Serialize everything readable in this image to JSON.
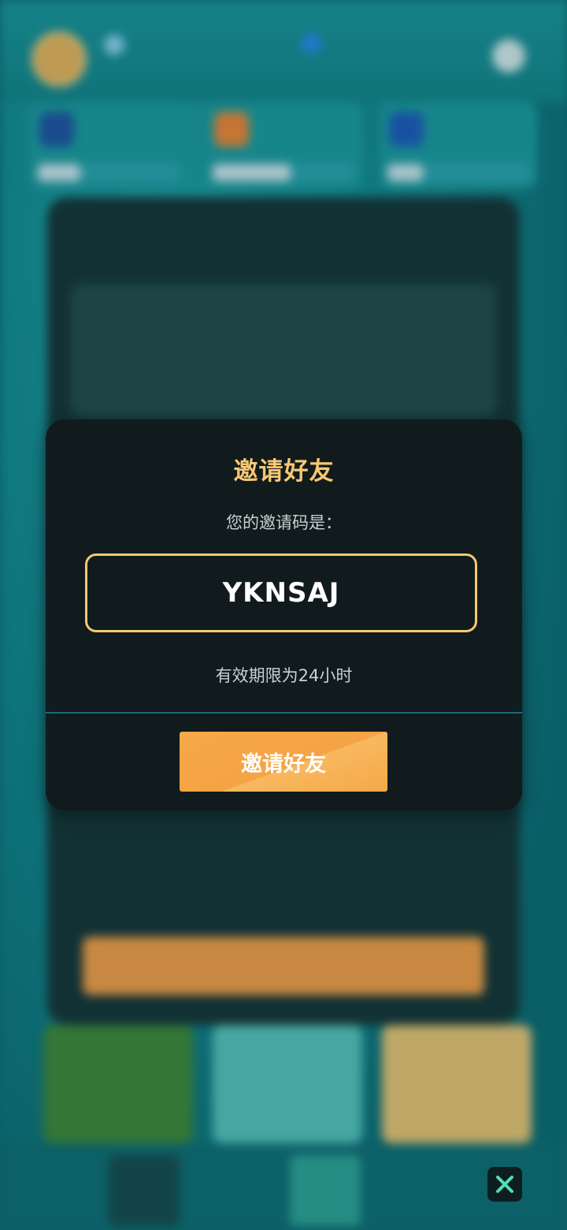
{
  "modal": {
    "title": "邀请好友",
    "subtitle": "您的邀请码是：",
    "invite_code": "YKNSAJ",
    "validity": "有效期限为24小时",
    "button_label": "邀请好友"
  },
  "colors": {
    "accent_gold": "#f6c874",
    "button_orange": "#f5a345",
    "modal_bg": "#121b1d",
    "divider": "#1c6b78"
  },
  "icons": {
    "close": "close-icon"
  }
}
